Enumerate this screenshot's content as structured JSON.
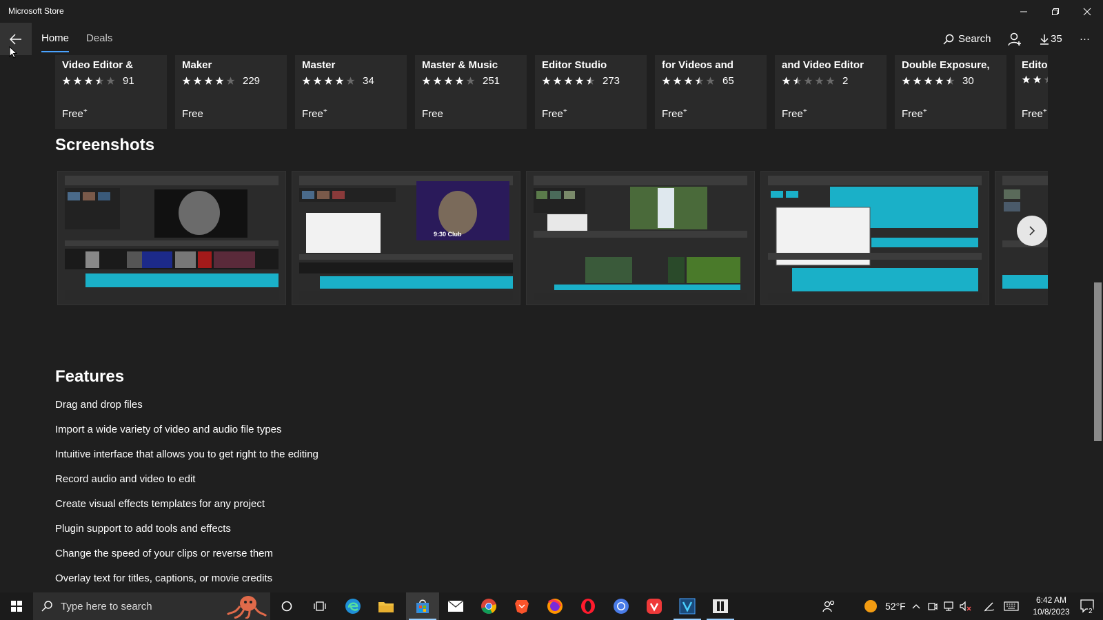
{
  "window": {
    "title": "Microsoft Store"
  },
  "nav": {
    "tabs": [
      {
        "label": "Home"
      },
      {
        "label": "Deals"
      }
    ],
    "search_label": "Search",
    "downloads_count": "35",
    "more_label": "···"
  },
  "app_cards": [
    {
      "name": "Video Editor &",
      "rating": 3.5,
      "reviews": "91",
      "price": "Free",
      "price_plus": "+"
    },
    {
      "name": "Maker",
      "rating": 4.0,
      "reviews": "229",
      "price": "Free",
      "price_plus": ""
    },
    {
      "name": "Master",
      "rating": 4.0,
      "reviews": "34",
      "price": "Free",
      "price_plus": "+"
    },
    {
      "name": "Master & Music",
      "rating": 4.0,
      "reviews": "251",
      "price": "Free",
      "price_plus": ""
    },
    {
      "name": "Editor Studio",
      "rating": 4.5,
      "reviews": "273",
      "price": "Free",
      "price_plus": "+"
    },
    {
      "name": "for Videos and",
      "rating": 3.5,
      "reviews": "65",
      "price": "Free",
      "price_plus": "+"
    },
    {
      "name": "and Video Editor",
      "rating": 1.5,
      "reviews": "2",
      "price": "Free",
      "price_plus": "+"
    },
    {
      "name": "Double Exposure,",
      "rating": 4.5,
      "reviews": "30",
      "price": "Free",
      "price_plus": "+"
    },
    {
      "name": "Editor",
      "rating": 2.0,
      "reviews": "",
      "price": "Free",
      "price_plus": "+"
    }
  ],
  "screenshots": {
    "title": "Screenshots",
    "items": [
      {
        "overlay": ""
      },
      {
        "overlay": "9:30 Club"
      },
      {
        "overlay": ""
      },
      {
        "overlay": ""
      }
    ]
  },
  "features": {
    "title": "Features",
    "items": [
      "Drag and drop files",
      "Import a wide variety of video and audio file types",
      "Intuitive interface that allows you to get right to the editing",
      "Record audio and video to edit",
      "Create visual effects templates for any project",
      "Plugin support to add tools and effects",
      "Change the speed of your clips or reverse them",
      "Overlay text for titles, captions, or movie credits"
    ]
  },
  "taskbar": {
    "search_placeholder": "Type here to search",
    "weather": "52°F",
    "time": "6:42 AM",
    "date": "10/8/2023",
    "notifications": "2",
    "colors": {
      "accent": "#9ad0ff",
      "weather": "#f39c12"
    }
  }
}
